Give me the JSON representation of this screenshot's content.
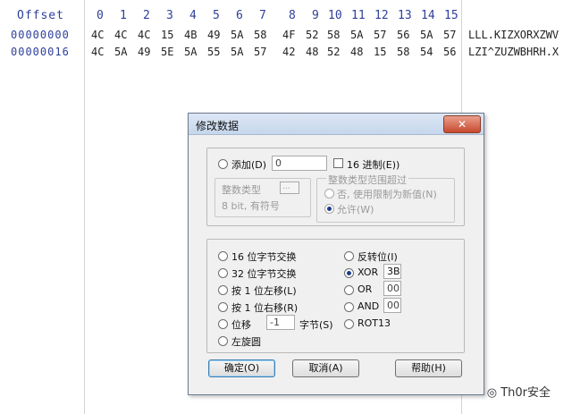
{
  "hex_view": {
    "offset_header": "Offset",
    "columns": [
      "0",
      "1",
      "2",
      "3",
      "4",
      "5",
      "6",
      "7",
      "8",
      "9",
      "10",
      "11",
      "12",
      "13",
      "14",
      "15"
    ],
    "rows": [
      {
        "offset": "00000000",
        "bytes": [
          "4C",
          "4C",
          "4C",
          "15",
          "4B",
          "49",
          "5A",
          "58",
          "4F",
          "52",
          "58",
          "5A",
          "57",
          "56",
          "5A",
          "57"
        ],
        "ascii": "LLL.KIZXORXZWV"
      },
      {
        "offset": "00000016",
        "bytes": [
          "4C",
          "5A",
          "49",
          "5E",
          "5A",
          "55",
          "5A",
          "57",
          "42",
          "48",
          "52",
          "48",
          "15",
          "58",
          "54",
          "56"
        ],
        "ascii": "LZI^ZUZWBHRH.X"
      }
    ]
  },
  "dialog": {
    "title": "修改数据",
    "close_label": "✕",
    "add": {
      "label": "添加(D)",
      "value": "0",
      "hex_label": "16 进制(E))"
    },
    "integer_type": {
      "title": "整数类型",
      "value": "8 bit, 有符号",
      "browse": "..."
    },
    "overflow": {
      "title": "整数类型范围超过",
      "option_no": "否, 使用限制为新值(N)",
      "option_allow": "允许(W)"
    },
    "ops": {
      "swap16": "16 位字节交换",
      "swap32": "32 位字节交换",
      "shl": "按 1 位左移(L)",
      "shr": "按 1 位右移(R)",
      "shift": "位移",
      "shift_value": "-1",
      "shift_unit": "字节(S)",
      "rotate": "左旋圆",
      "invert": "反转位(I)",
      "xor": "XOR",
      "xor_value": "3B",
      "or": "OR",
      "or_value": "00",
      "and": "AND",
      "and_value": "00",
      "rot13": "ROT13"
    },
    "buttons": {
      "ok": "确定(O)",
      "cancel": "取消(A)",
      "help": "帮助(H)"
    }
  },
  "watermark": "Th0r安全",
  "colors": {
    "header_text": "#2e3f9a",
    "dialog_bg": "#f0f0f0",
    "selected_radio": "#1e3e8a"
  }
}
